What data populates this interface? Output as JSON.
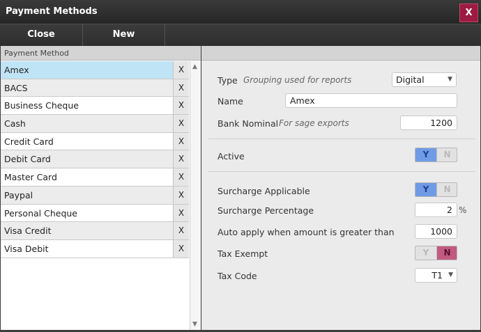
{
  "window": {
    "title": "Payment Methods",
    "close_label": "X"
  },
  "toolbar": {
    "close_label": "Close",
    "new_label": "New"
  },
  "list": {
    "column_header": "Payment Method",
    "delete_label": "X",
    "items": [
      {
        "label": "Amex"
      },
      {
        "label": "BACS"
      },
      {
        "label": "Business Cheque"
      },
      {
        "label": "Cash"
      },
      {
        "label": "Credit Card"
      },
      {
        "label": "Debit Card"
      },
      {
        "label": "Master Card"
      },
      {
        "label": "Paypal"
      },
      {
        "label": "Personal Cheque"
      },
      {
        "label": "Visa Credit"
      },
      {
        "label": "Visa Debit"
      }
    ],
    "selected": "Amex",
    "scroll_up_icon": "triangle-up-icon",
    "scroll_down_icon": "triangle-down-icon"
  },
  "form": {
    "type": {
      "label": "Type",
      "hint": "Grouping used for reports",
      "value": "Digital"
    },
    "name": {
      "label": "Name",
      "value": "Amex"
    },
    "bank_nominal": {
      "label": "Bank Nominal",
      "hint": "For sage exports",
      "value": "1200"
    },
    "active": {
      "label": "Active",
      "yes": "Y",
      "no": "N",
      "value": "Y"
    },
    "surcharge_applicable": {
      "label": "Surcharge Applicable",
      "yes": "Y",
      "no": "N",
      "value": "Y"
    },
    "surcharge_percentage": {
      "label": "Surcharge Percentage",
      "value": "2",
      "unit": "%"
    },
    "auto_apply": {
      "label": "Auto apply when amount is greater than",
      "value": "1000"
    },
    "tax_exempt": {
      "label": "Tax Exempt",
      "yes": "Y",
      "no": "N",
      "value": "N"
    },
    "tax_code": {
      "label": "Tax Code",
      "value": "T1"
    }
  },
  "colors": {
    "selected_row": "#bfe4f5",
    "toggle_blue": "#6f9be5",
    "toggle_red": "#c25a80",
    "close_button": "#9b1b43"
  }
}
